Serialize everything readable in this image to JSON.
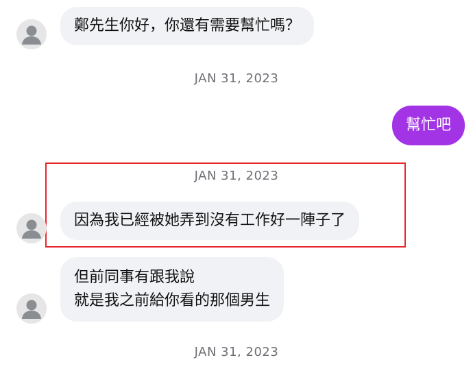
{
  "messages": [
    {
      "side": "in",
      "text": "鄭先生你好，你還有需要幫忙嗎？"
    },
    {
      "side": "date",
      "text": "JAN 31, 2023"
    },
    {
      "side": "out",
      "text": "幫忙吧"
    },
    {
      "side": "date",
      "text": "JAN 31, 2023"
    },
    {
      "side": "in",
      "text": "因為我已經被她弄到沒有工作好一陣子了"
    },
    {
      "side": "in",
      "lines": [
        "但前同事有跟我說",
        "就是我之前給你看的那個男生"
      ]
    },
    {
      "side": "date",
      "text": "JAN 31, 2023"
    }
  ],
  "colors": {
    "incoming_bubble": "#f1f2f5",
    "outgoing_bubble": "#a234e6",
    "timestamp": "#6d6f75",
    "highlight_border": "#e8262b"
  },
  "icons": {
    "avatar": "default-user-icon"
  }
}
